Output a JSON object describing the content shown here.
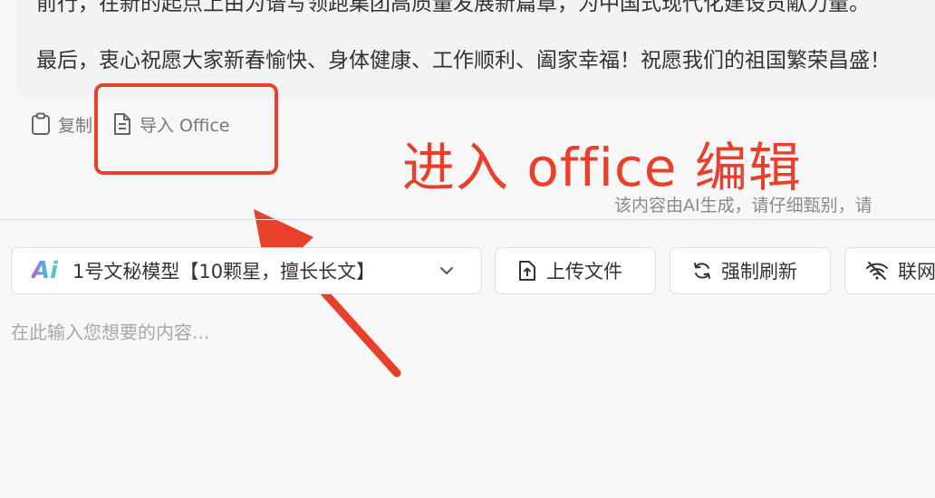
{
  "message": {
    "line_1": "前行，在新的起点上由为谱写领跑集团高质量发展新篇章，为中国式现代化建设贡献力量。",
    "line_2": "最后，衷心祝愿大家新春愉快、身体健康、工作顺利、阖家幸福！祝愿我们的祖国繁荣昌盛！"
  },
  "actions": {
    "copy_label": "复制",
    "office_label": "导入 Office"
  },
  "annotation": {
    "text": "进入 office 编辑",
    "color": "#e8402a"
  },
  "disclaimer": "该内容由AI生成，请仔细甄别，请",
  "toolbar": {
    "model_icon": "Ai",
    "model_label": "1号文秘模型【10颗星，擅长长文】",
    "upload_label": "上传文件",
    "refresh_label": "强制刷新",
    "network_label": "联网"
  },
  "input": {
    "placeholder": "在此输入您想要的内容..."
  }
}
